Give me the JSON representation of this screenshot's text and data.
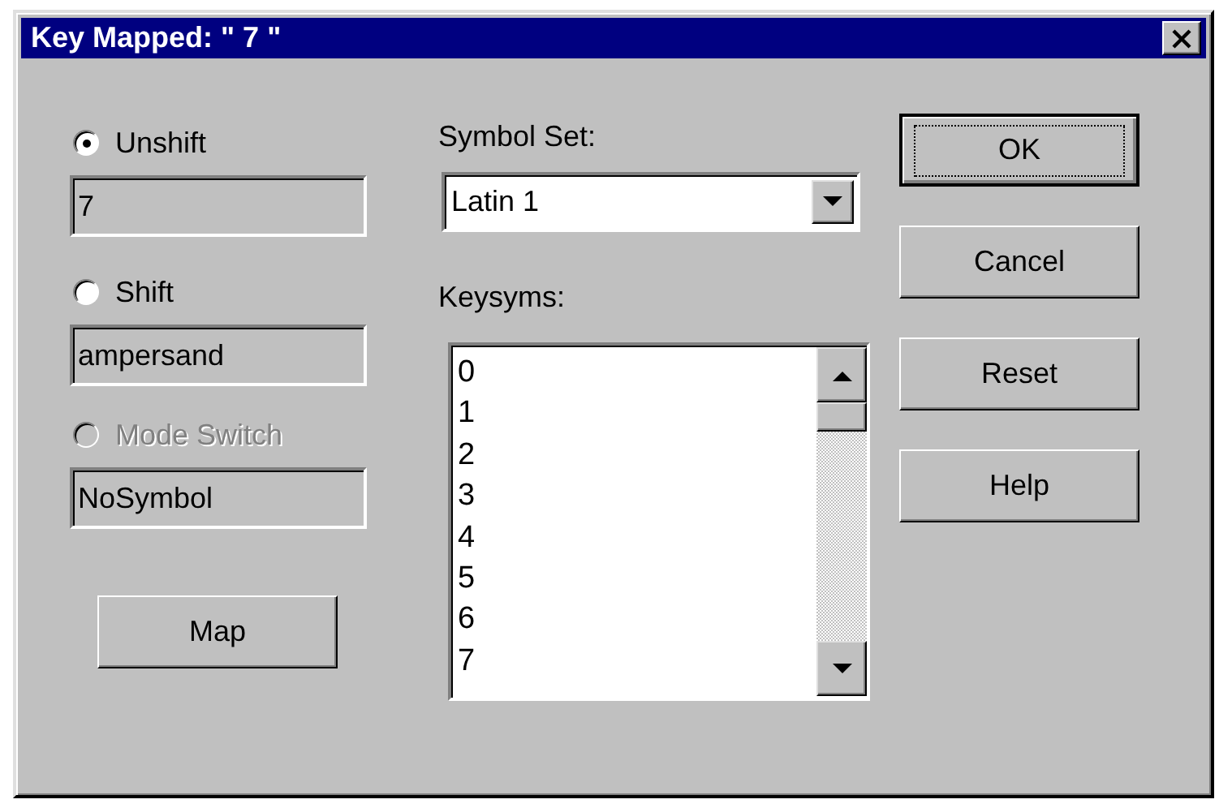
{
  "window": {
    "title": "Key Mapped: \" 7 \""
  },
  "modes": [
    {
      "label": "Unshift",
      "selected": true,
      "disabled": false,
      "value": "7"
    },
    {
      "label": "Shift",
      "selected": false,
      "disabled": false,
      "value": "ampersand"
    },
    {
      "label": "Mode Switch",
      "selected": false,
      "disabled": true,
      "value": "NoSymbol"
    }
  ],
  "map_button": "Map",
  "symbol_set": {
    "label": "Symbol Set:",
    "value": "Latin 1"
  },
  "keysyms": {
    "label": "Keysyms:",
    "items": [
      "0",
      "1",
      "2",
      "3",
      "4",
      "5",
      "6",
      "7"
    ]
  },
  "buttons": [
    {
      "label": "OK",
      "default": true
    },
    {
      "label": "Cancel",
      "default": false
    },
    {
      "label": "Reset",
      "default": false
    },
    {
      "label": "Help",
      "default": false
    }
  ]
}
